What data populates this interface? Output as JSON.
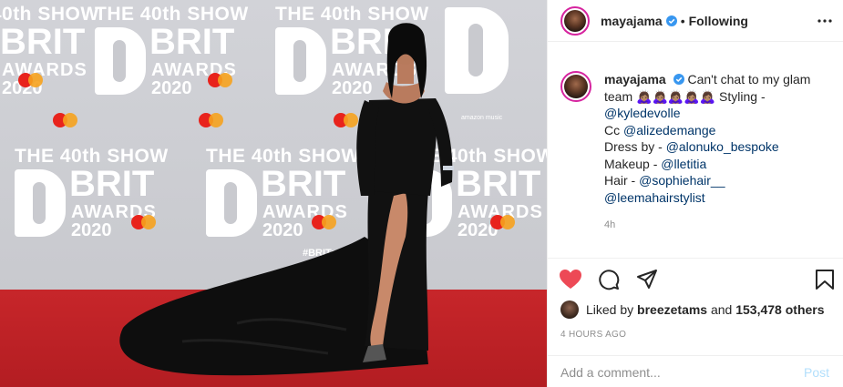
{
  "photo": {
    "backdrop": {
      "show_text": "THE 40th SHOW",
      "brit_text": "BRIT",
      "awards_text": "AWARDS",
      "year_text": "2020",
      "hashtag": "#BRITs",
      "sponsor": "amazon music"
    },
    "colors": {
      "carpet": "#c0232a",
      "backdrop": "#cdced3",
      "gown": "#111111"
    }
  },
  "header": {
    "username": "mayajama",
    "verified_icon": "verified-badge-icon",
    "separator": "•",
    "follow_status": "Following",
    "more_icon": "more-options-icon"
  },
  "caption": {
    "username": "mayajama",
    "text_start": "Can't chat to my glam team 🙇🏽‍♀️🙇🏽‍♀️🙇🏽‍♀️🙇🏽‍♀️🙇🏽‍♀️ Styling -",
    "stylist": "@kyledevolle",
    "cc_label": "Cc",
    "cc_mention": "@alizedemange",
    "dress_label": "Dress by -",
    "dress_mention": "@alonuko_bespoke",
    "makeup_label": "Makeup -",
    "makeup_mention": "@lletitia",
    "hair_label": "Hair -",
    "hair_mention": "@sophiehair__",
    "hair_mention_2": "@leemahairstylist",
    "age": "4h"
  },
  "actions": {
    "like_icon": "heart-filled-icon",
    "comment_icon": "comment-icon",
    "share_icon": "share-icon",
    "save_icon": "bookmark-icon",
    "like_color": "#ed4956"
  },
  "likes": {
    "prefix": "Liked by",
    "user": "breezetams",
    "middle": "and",
    "count": "153,478 others"
  },
  "timestamp": "4 HOURS AGO",
  "comment": {
    "placeholder": "Add a comment...",
    "post_label": "Post"
  }
}
